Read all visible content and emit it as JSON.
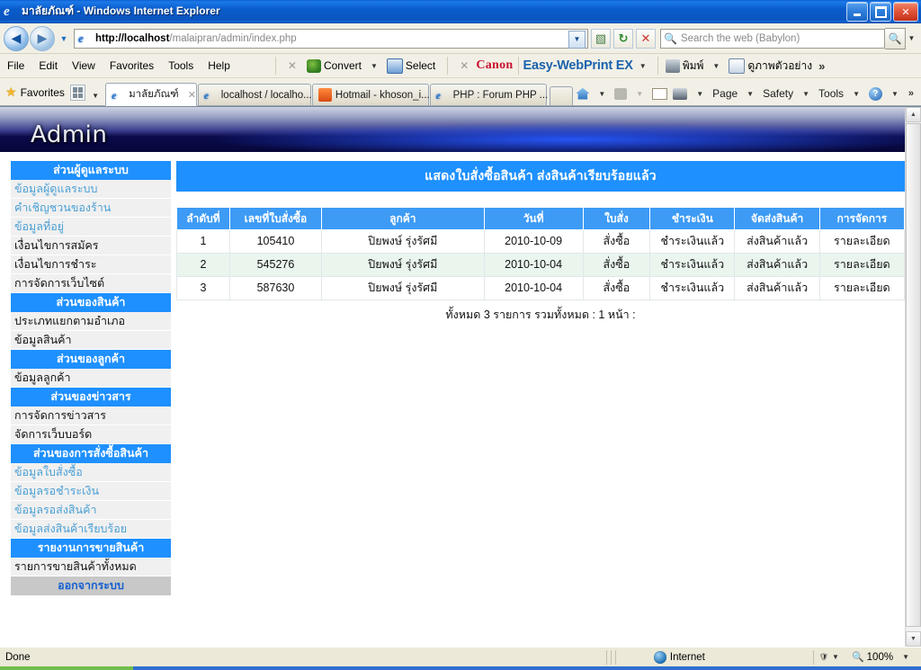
{
  "window": {
    "title": "มาลัยภัณฑ์ - Windows Internet Explorer",
    "minimize_label": "Minimize",
    "maximize_label": "Maximize",
    "close_label": "Close"
  },
  "address_bar": {
    "back_label": "←",
    "forward_label": "→",
    "history_label": "▼",
    "url_host": "http://localhost",
    "url_rest": "/malaipran/admin/index.php",
    "url_full": "http://localhost/malaipran/admin/index.php",
    "go_label": "→",
    "refresh_label": "↻",
    "stop_label": "✕",
    "search_placeholder": "Search the web (Babylon)",
    "search_value": "",
    "search_go_label": "🔍",
    "search_dropdown_label": "▼"
  },
  "menu_bar": {
    "items": [
      "File",
      "Edit",
      "View",
      "Favorites",
      "Tools",
      "Help"
    ],
    "addons": [
      {
        "label": "Convert",
        "icon": "convert-icon",
        "has_dropdown": true
      },
      {
        "label": "Select",
        "icon": "select-icon",
        "has_dropdown": false
      }
    ],
    "close_addon_label": "✕",
    "canon_label": "Canon",
    "easy_webprint_label": "Easy-WebPrint EX",
    "print_label": "พิมพ์",
    "preview_label": "ดูภาพตัวอย่าง",
    "overflow_label": "»"
  },
  "favorites_bar": {
    "favorites_label": "Favorites",
    "quick_tabs_label": "Quick Tabs",
    "quick_dropdown_label": "▼"
  },
  "tabs": [
    {
      "label": "มาลัยภัณฑ์",
      "active": true,
      "closable": true,
      "close_label": "✕"
    },
    {
      "label": "localhost / localho...",
      "active": false,
      "closable": false
    },
    {
      "label": "Hotmail - khoson_i...",
      "active": false,
      "closable": false
    },
    {
      "label": "PHP : Forum PHP ...",
      "active": false,
      "closable": false
    }
  ],
  "command_bar": {
    "home_label": "Home",
    "feeds_label": "Feeds",
    "mail_label": "Mail",
    "print_label": "Print",
    "page_label": "Page",
    "safety_label": "Safety",
    "tools_label": "Tools",
    "help_label": "?",
    "overflow_label": "»"
  },
  "banner": {
    "title": "Admin"
  },
  "sidebar": {
    "sections": [
      {
        "header": "ส่วนผู้ดูแลระบบ",
        "style": "blue",
        "items": [
          {
            "label": "ข้อมูลผู้ดูแลระบบ",
            "visited": true
          },
          {
            "label": "คำเชิญชวนของร้าน",
            "visited": true
          },
          {
            "label": "ข้อมูลที่อยู่",
            "visited": true
          },
          {
            "label": "เงื่อนไขการสมัคร",
            "visited": false
          },
          {
            "label": "เงื่อนไขการชำระ",
            "visited": false
          },
          {
            "label": "การจัดการเว็บไซต์",
            "visited": false
          }
        ]
      },
      {
        "header": "ส่วนของสินค้า",
        "style": "blue",
        "items": [
          {
            "label": "ประเภทแยกตามอำเภอ",
            "visited": false
          },
          {
            "label": "ข้อมูลสินค้า",
            "visited": false
          }
        ]
      },
      {
        "header": "ส่วนของลูกค้า",
        "style": "blue",
        "items": [
          {
            "label": "ข้อมูลลูกค้า",
            "visited": false
          }
        ]
      },
      {
        "header": "ส่วนของข่าวสาร",
        "style": "blue",
        "items": [
          {
            "label": "การจัดการข่าวสาร",
            "visited": false
          },
          {
            "label": "จัดการเว็บบอร์ด",
            "visited": false
          }
        ]
      },
      {
        "header": "ส่วนของการสั่งซื้อสินค้า",
        "style": "blue",
        "items": [
          {
            "label": "ข้อมูลใบสั่งซื้อ",
            "visited": true
          },
          {
            "label": "ข้อมูลรอชำระเงิน",
            "visited": true
          },
          {
            "label": "ข้อมูลรอส่งสินค้า",
            "visited": true
          },
          {
            "label": "ข้อมูลส่งสินค้าเรียบร้อย",
            "visited": true
          }
        ]
      },
      {
        "header": "รายงานการขายสินค้า",
        "style": "blue",
        "items": [
          {
            "label": "รายการขายสินค้าทั้งหมด",
            "visited": false
          }
        ]
      },
      {
        "header": "ออกจากระบบ",
        "style": "gray",
        "items": []
      }
    ]
  },
  "main": {
    "page_title": "แสดงใบสั่งซื้อสินค้า ส่งสินค้าเรียบร้อยแล้ว",
    "table": {
      "columns": [
        "ลำดับที่",
        "เลขที่ใบสั่งซื้อ",
        "ลูกค้า",
        "วันที่",
        "ใบสั่ง",
        "ชำระเงิน",
        "จัดส่งสินค้า",
        "การจัดการ"
      ],
      "rows": [
        {
          "no": "1",
          "order_no": "105410",
          "customer": "ปิยพงษ์ รุ่งรัศมี",
          "date": "2010-10-09",
          "order_status": "สั่งซื้อ",
          "payment_status": "ชำระเงินแล้ว",
          "shipping_status": "ส่งสินค้าแล้ว",
          "action": "รายละเอียด"
        },
        {
          "no": "2",
          "order_no": "545276",
          "customer": "ปิยพงษ์ รุ่งรัศมี",
          "date": "2010-10-04",
          "order_status": "สั่งซื้อ",
          "payment_status": "ชำระเงินแล้ว",
          "shipping_status": "ส่งสินค้าแล้ว",
          "action": "รายละเอียด"
        },
        {
          "no": "3",
          "order_no": "587630",
          "customer": "ปิยพงษ์ รุ่งรัศมี",
          "date": "2010-10-04",
          "order_status": "สั่งซื้อ",
          "payment_status": "ชำระเงินแล้ว",
          "shipping_status": "ส่งสินค้าแล้ว",
          "action": "รายละเอียด"
        }
      ]
    },
    "summary": "ทั้งหมด 3 รายการ รวมทั้งหมด : 1 หน้า :"
  },
  "status_bar": {
    "status": "Done",
    "zone": "Internet",
    "zoom": "100%",
    "zone_dropdown": "▼",
    "zoom_dropdown": "▼"
  },
  "colors": {
    "accent_blue": "#1e90ff",
    "header_blue": "#3d9bf5",
    "alt_row": "#eaf5ee",
    "link": "#4a9fd4",
    "titlebar": "#0a55c0"
  }
}
